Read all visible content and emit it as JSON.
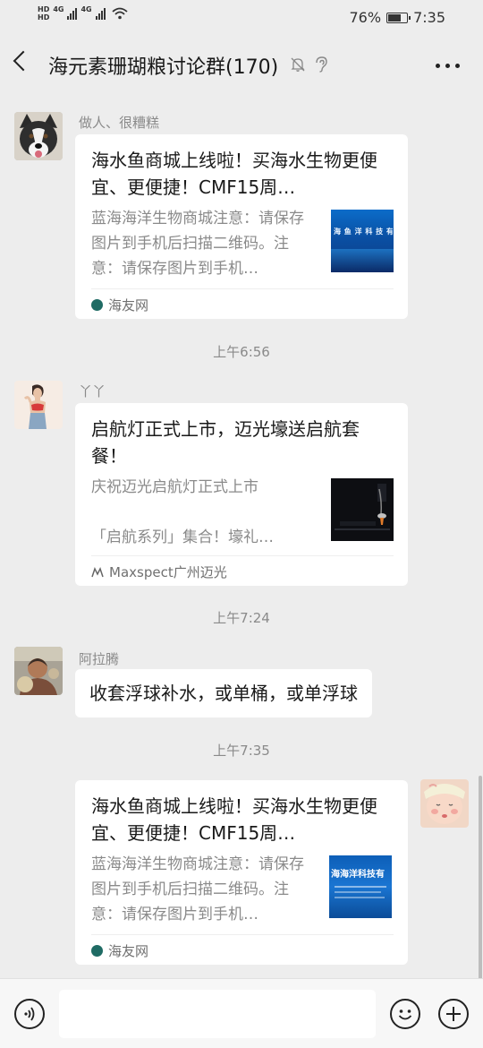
{
  "status_bar": {
    "hd1": "HD",
    "hd2": "HD",
    "net1": "4G",
    "net2": "4G",
    "battery_pct": "76%",
    "battery_level": 0.76,
    "time": "7:35"
  },
  "header": {
    "title": "海元素珊瑚粮讨论群(170)",
    "icons": [
      "back-icon",
      "mute-icon",
      "ear-icon",
      "more-icon"
    ]
  },
  "messages": [
    {
      "sender": "做人、很糟糕",
      "card_title": "海水鱼商城上线啦！买海水生物更便宜、更便捷！CMF15周…",
      "card_desc": "蓝海海洋生物商城注意：请保存图片到手机后扫描二维码。注意：请保存图片到手机…",
      "source": "海友网"
    },
    {
      "time": "上午6:56"
    },
    {
      "sender": "丫丫",
      "card_title": "启航灯正式上市，迈光壕送启航套餐！",
      "card_desc": "庆祝迈光启航灯正式上市\n\n「启航系列」集合！壕礼…",
      "source": "Maxspect广州迈光"
    },
    {
      "time": "上午7:24"
    },
    {
      "sender": "阿拉腾",
      "text": "收套浮球补水，或单桶，或单浮球"
    },
    {
      "time": "上午7:35"
    },
    {
      "sender": "",
      "card_title": "海水鱼商城上线啦！买海水生物更便宜、更便捷！CMF15周…",
      "card_desc": "蓝海海洋生物商城注意：请保存图片到手机后扫描二维码。注意：请保存图片到手机…",
      "source": "海友网"
    }
  ],
  "thumb_texts": {
    "card1": "海 鱼 洋 科 技 有",
    "card3": "海海洋科技有"
  },
  "input_bar": {
    "icons": [
      "voice-icon",
      "emoji-icon",
      "plus-icon"
    ]
  }
}
